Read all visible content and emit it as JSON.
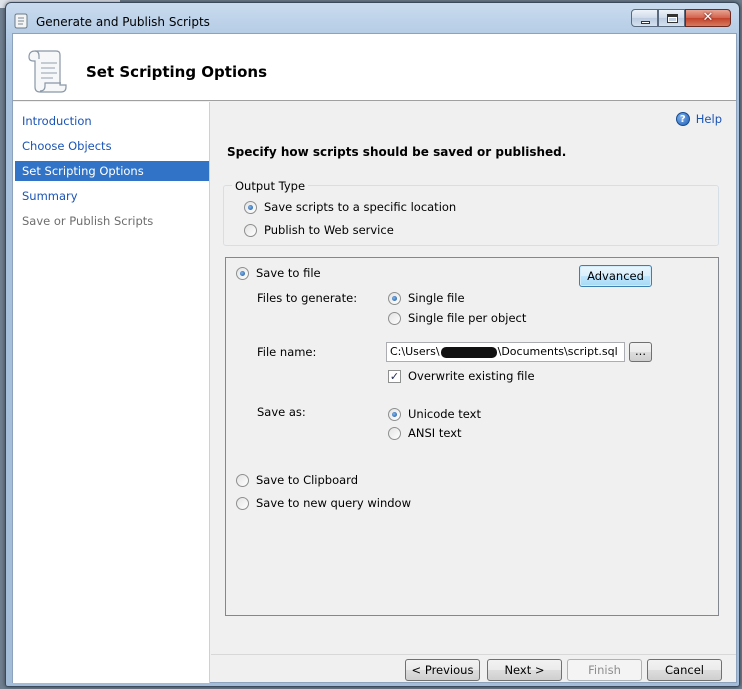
{
  "window": {
    "title": "Generate and Publish Scripts"
  },
  "header": {
    "title": "Set Scripting Options"
  },
  "sidebar": {
    "items": [
      {
        "label": "Introduction",
        "state": "link"
      },
      {
        "label": "Choose Objects",
        "state": "link"
      },
      {
        "label": "Set Scripting Options",
        "state": "active"
      },
      {
        "label": "Summary",
        "state": "link"
      },
      {
        "label": "Save or Publish Scripts",
        "state": "disabled"
      }
    ]
  },
  "help": {
    "label": "Help",
    "icon": "help-icon"
  },
  "instruction": "Specify how scripts should be saved or published.",
  "output_type": {
    "label": "Output Type",
    "options": [
      {
        "label": "Save scripts to a specific location",
        "selected": true
      },
      {
        "label": "Publish to Web service",
        "selected": false
      }
    ]
  },
  "save_options": {
    "save_to_file": {
      "label": "Save to file",
      "selected": true
    },
    "advanced_label": "Advanced",
    "files_to_generate": {
      "label": "Files to generate:",
      "options": [
        {
          "label": "Single file",
          "selected": true
        },
        {
          "label": "Single file per object",
          "selected": false
        }
      ]
    },
    "file_name": {
      "label": "File name:",
      "value_prefix": "C:\\Users\\",
      "value_suffix": "\\Documents\\script.sql",
      "browse_label": "..."
    },
    "overwrite": {
      "label": "Overwrite existing file",
      "checked": true
    },
    "save_as": {
      "label": "Save as:",
      "options": [
        {
          "label": "Unicode text",
          "selected": true
        },
        {
          "label": "ANSI text",
          "selected": false
        }
      ]
    },
    "save_to_clipboard": {
      "label": "Save to Clipboard",
      "selected": false
    },
    "save_to_query_window": {
      "label": "Save to new query window",
      "selected": false
    }
  },
  "footer": {
    "previous_label": "< Previous",
    "next_label": "Next >",
    "finish_label": "Finish",
    "cancel_label": "Cancel"
  }
}
